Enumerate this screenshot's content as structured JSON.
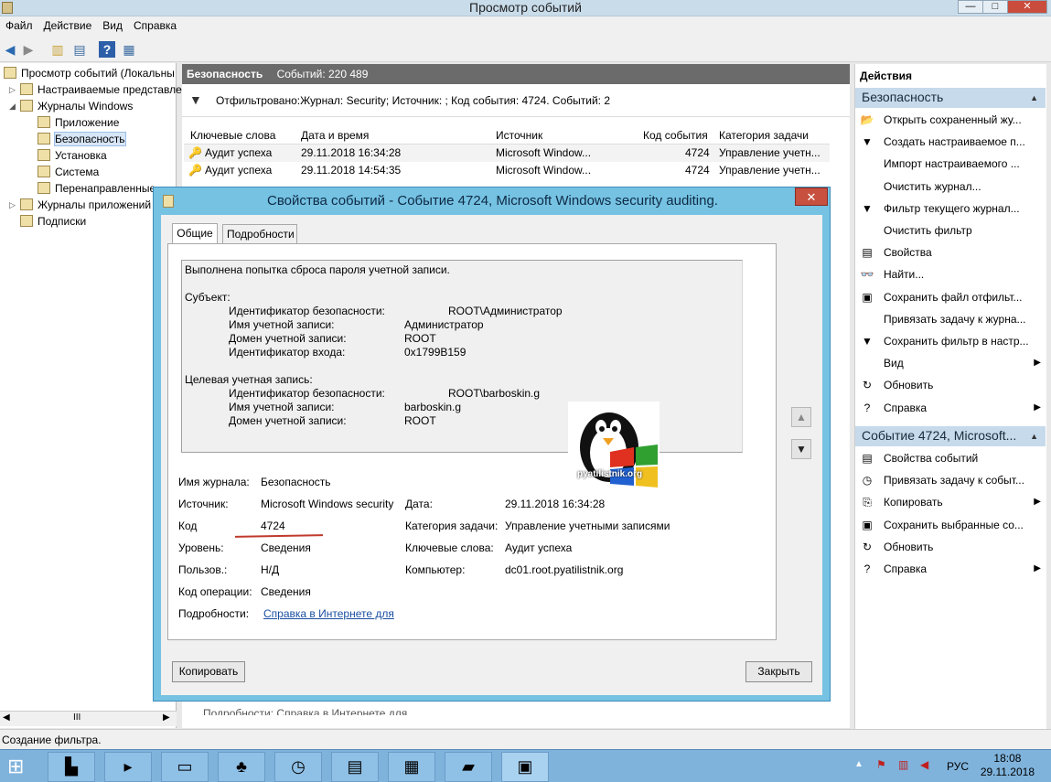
{
  "window": {
    "title": "Просмотр событий",
    "controls": [
      "—",
      "□",
      "✕"
    ]
  },
  "menu": [
    "Файл",
    "Действие",
    "Вид",
    "Справка"
  ],
  "tree": {
    "root": "Просмотр событий (Локальны",
    "custom_views": "Настраиваемые представле",
    "windows_logs": "Журналы Windows",
    "logs": [
      "Приложение",
      "Безопасность",
      "Установка",
      "Система",
      "Перенаправленные"
    ],
    "app_logs": "Журналы приложений",
    "subscriptions": "Подписки",
    "scroll_glyph": "III"
  },
  "center": {
    "title": "Безопасность",
    "events_count": "Событий: 220 489",
    "filter_text": "Отфильтровано:Журнал: Security; Источник: ; Код события: 4724. Событий: 2",
    "columns": [
      "Ключевые слова",
      "Дата и время",
      "Источник",
      "Код события",
      "Категория задачи"
    ],
    "rows": [
      {
        "keywords": "Аудит успеха",
        "datetime": "29.11.2018 16:34:28",
        "source": "Microsoft Window...",
        "code": "4724",
        "category": "Управление учетн..."
      },
      {
        "keywords": "Аудит успеха",
        "datetime": "29.11.2018 14:54:35",
        "source": "Microsoft Window...",
        "code": "4724",
        "category": "Управление учетн..."
      }
    ],
    "bottom_hint": "Подробности:   Справка в Интернете для"
  },
  "actions": {
    "title": "Действия",
    "section1": "Безопасность",
    "items1": [
      {
        "label": "Открыть сохраненный жу...",
        "icon": "folder-open-icon",
        "glyph": "📂"
      },
      {
        "label": "Создать настраиваемое п...",
        "icon": "filter-icon",
        "glyph": "▼"
      },
      {
        "label": "Импорт настраиваемого ...",
        "icon": "none",
        "glyph": ""
      },
      {
        "label": "Очистить журнал...",
        "icon": "none",
        "glyph": ""
      },
      {
        "label": "Фильтр текущего журнал...",
        "icon": "filter-icon",
        "glyph": "▼"
      },
      {
        "label": "Очистить фильтр",
        "icon": "none",
        "glyph": ""
      },
      {
        "label": "Свойства",
        "icon": "properties-icon",
        "glyph": "▤"
      },
      {
        "label": "Найти...",
        "icon": "binoculars-icon",
        "glyph": "👓"
      },
      {
        "label": "Сохранить файл отфильт...",
        "icon": "save-icon",
        "glyph": "▣"
      },
      {
        "label": "Привязать задачу к журна...",
        "icon": "none",
        "glyph": ""
      },
      {
        "label": "Сохранить фильтр в настр...",
        "icon": "filter-save-icon",
        "glyph": "▼"
      },
      {
        "label": "Вид",
        "icon": "none",
        "glyph": "",
        "arrow": "▶"
      },
      {
        "label": "Обновить",
        "icon": "refresh-icon",
        "glyph": "↻"
      },
      {
        "label": "Справка",
        "icon": "help-icon",
        "glyph": "?",
        "arrow": "▶"
      }
    ],
    "section2": "Событие 4724, Microsoft...",
    "items2": [
      {
        "label": "Свойства событий",
        "icon": "properties-icon",
        "glyph": "▤"
      },
      {
        "label": "Привязать задачу к событ...",
        "icon": "task-icon",
        "glyph": "◷"
      },
      {
        "label": "Копировать",
        "icon": "copy-icon",
        "glyph": "⎘",
        "arrow": "▶"
      },
      {
        "label": "Сохранить выбранные со...",
        "icon": "save-icon",
        "glyph": "▣"
      },
      {
        "label": "Обновить",
        "icon": "refresh-icon",
        "glyph": "↻"
      },
      {
        "label": "Справка",
        "icon": "help-icon",
        "glyph": "?",
        "arrow": "▶"
      }
    ]
  },
  "status": "Создание фильтра.",
  "dialog": {
    "title": "Свойства событий - Событие 4724, Microsoft Windows security auditing.",
    "close": "✕",
    "tabs": [
      "Общие",
      "Подробности"
    ],
    "description": {
      "line1": "Выполнена попытка сброса пароля учетной записи.",
      "subject_header": "Субъект:",
      "subject": [
        {
          "k": "Идентификатор безопасности:",
          "v": "ROOT\\Администратор"
        },
        {
          "k": "Имя учетной записи:",
          "v": "Администратор"
        },
        {
          "k": "Домен учетной записи:",
          "v": "ROOT"
        },
        {
          "k": "Идентификатор входа:",
          "v": "0x1799B159"
        }
      ],
      "target_header": "Целевая учетная запись:",
      "target": [
        {
          "k": "Идентификатор безопасности:",
          "v": "ROOT\\barboskin.g"
        },
        {
          "k": "Имя учетной записи:",
          "v": "barboskin.g"
        },
        {
          "k": "Домен учетной записи:",
          "v": "ROOT"
        }
      ]
    },
    "watermark": "pyatilistnik.org",
    "props": {
      "log_name_label": "Имя журнала:",
      "log_name": "Безопасность",
      "source_label": "Источник:",
      "source": "Microsoft Windows security",
      "date_label": "Дата:",
      "date": "29.11.2018 16:34:28",
      "code_label": "Код",
      "code": "4724",
      "category_label": "Категория задачи:",
      "category": "Управление учетными записями",
      "level_label": "Уровень:",
      "level": "Сведения",
      "keywords_label": "Ключевые слова:",
      "keywords": "Аудит успеха",
      "user_label": "Пользов.:",
      "user": "Н/Д",
      "computer_label": "Компьютер:",
      "computer": "dc01.root.pyatilistnik.org",
      "opcode_label": "Код операции:",
      "opcode": "Сведения",
      "details_label": "Подробности:",
      "details_link": "Справка в Интернете для"
    },
    "copy_button": "Копировать",
    "close_button": "Закрыть",
    "accent": "#c0392b"
  },
  "taskbar": {
    "lang": "РУС",
    "time": "18:08",
    "date": "29.11.2018"
  }
}
